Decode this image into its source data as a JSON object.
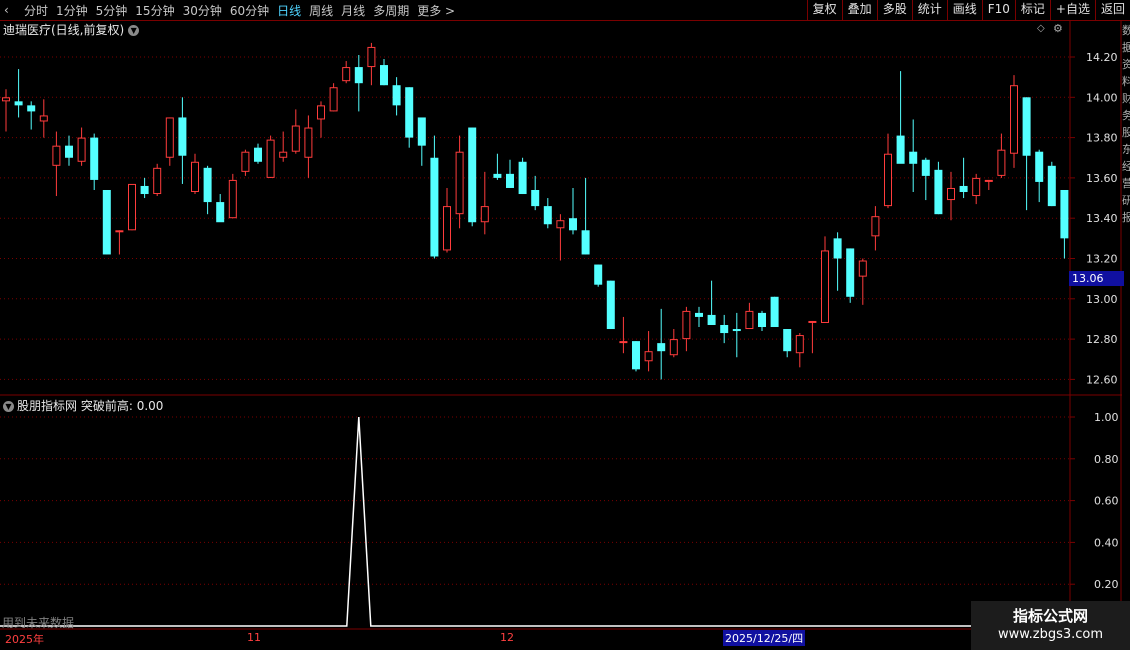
{
  "toolbar": {
    "back_glyph": "‹",
    "periods": [
      "分时",
      "1分钟",
      "5分钟",
      "15分钟",
      "30分钟",
      "60分钟",
      "日线",
      "周线",
      "月线",
      "多周期",
      "更多 >"
    ],
    "active_period": "日线",
    "tools": [
      "复权",
      "叠加",
      "多股",
      "统计",
      "画线",
      "F10",
      "标记",
      "+自选",
      "返回"
    ]
  },
  "main_title": "迪瑞医疗(日线,前复权)",
  "current_price_label": "13.06",
  "price_axis_labels": [
    "14.20",
    "14.00",
    "13.80",
    "13.60",
    "13.40",
    "13.20",
    "13.00",
    "12.80",
    "12.60"
  ],
  "indicator": {
    "name": "股朋指标网",
    "label": "突破前高:",
    "value": "0.00",
    "axis_labels": [
      "1.00",
      "0.80",
      "0.60",
      "0.40",
      "0.20"
    ],
    "peak_value": 1.0
  },
  "future_note": "用到未来数据",
  "date_axis": {
    "year": "2025年",
    "nov": "11",
    "dec": "12",
    "cursor_date": "2025/12/25/四"
  },
  "side_strip_text": "数据资料财务股东经营研报",
  "watermark": {
    "line1": "指标公式网",
    "line2": "www.zbgs3.com"
  },
  "colors": {
    "up": "#ff3c3c",
    "down": "#54ffff",
    "grid": "#7a0000",
    "line": "#ffffff"
  },
  "chart_data": {
    "type": "candlestick",
    "ylim": [
      12.52,
      14.3
    ],
    "candles": [
      [
        13.98,
        14.0,
        14.04,
        13.83
      ],
      [
        13.98,
        13.96,
        14.14,
        13.9
      ],
      [
        13.96,
        13.93,
        13.98,
        13.84
      ],
      [
        13.88,
        13.91,
        13.99,
        13.8
      ],
      [
        13.66,
        13.76,
        13.83,
        13.51
      ],
      [
        13.76,
        13.7,
        13.81,
        13.66
      ],
      [
        13.68,
        13.8,
        13.85,
        13.66
      ],
      [
        13.8,
        13.59,
        13.82,
        13.54
      ],
      [
        13.54,
        13.22,
        13.54,
        13.22
      ],
      [
        13.34,
        13.34,
        13.34,
        13.22
      ],
      [
        13.34,
        13.57,
        13.57,
        13.34
      ],
      [
        13.56,
        13.52,
        13.6,
        13.5
      ],
      [
        13.52,
        13.65,
        13.67,
        13.51
      ],
      [
        13.7,
        13.9,
        13.9,
        13.66
      ],
      [
        13.9,
        13.71,
        14.0,
        13.57
      ],
      [
        13.53,
        13.68,
        13.72,
        13.52
      ],
      [
        13.65,
        13.48,
        13.66,
        13.42
      ],
      [
        13.48,
        13.38,
        13.52,
        13.39
      ],
      [
        13.4,
        13.59,
        13.62,
        13.4
      ],
      [
        13.63,
        13.73,
        13.74,
        13.61
      ],
      [
        13.75,
        13.68,
        13.77,
        13.67
      ],
      [
        13.6,
        13.79,
        13.81,
        13.6
      ],
      [
        13.7,
        13.73,
        13.83,
        13.68
      ],
      [
        13.73,
        13.86,
        13.94,
        13.72
      ],
      [
        13.7,
        13.85,
        13.91,
        13.6
      ],
      [
        13.89,
        13.96,
        13.98,
        13.8
      ],
      [
        13.93,
        14.05,
        14.07,
        13.93
      ],
      [
        14.08,
        14.15,
        14.18,
        14.07
      ],
      [
        14.15,
        14.07,
        14.21,
        13.93
      ],
      [
        14.15,
        14.25,
        14.27,
        14.06
      ],
      [
        14.16,
        14.06,
        14.19,
        14.06
      ],
      [
        14.06,
        13.96,
        14.1,
        13.91
      ],
      [
        14.05,
        13.8,
        14.05,
        13.75
      ],
      [
        13.9,
        13.76,
        13.89,
        13.66
      ],
      [
        13.7,
        13.21,
        13.81,
        13.2
      ],
      [
        13.24,
        13.46,
        13.55,
        13.23
      ],
      [
        13.42,
        13.73,
        13.81,
        13.35
      ],
      [
        13.85,
        13.38,
        13.85,
        13.36
      ],
      [
        13.38,
        13.46,
        13.63,
        13.32
      ],
      [
        13.62,
        13.6,
        13.72,
        13.59
      ],
      [
        13.62,
        13.55,
        13.69,
        13.55
      ],
      [
        13.68,
        13.52,
        13.7,
        13.52
      ],
      [
        13.54,
        13.46,
        13.61,
        13.44
      ],
      [
        13.46,
        13.37,
        13.5,
        13.35
      ],
      [
        13.35,
        13.39,
        13.42,
        13.19
      ],
      [
        13.4,
        13.34,
        13.55,
        13.32
      ],
      [
        13.34,
        13.22,
        13.6,
        13.22
      ],
      [
        13.17,
        13.07,
        13.17,
        13.06
      ],
      [
        13.09,
        12.85,
        13.09,
        12.85
      ],
      [
        12.79,
        12.79,
        12.91,
        12.73
      ],
      [
        12.79,
        12.65,
        12.79,
        12.64
      ],
      [
        12.69,
        12.74,
        12.84,
        12.64
      ],
      [
        12.78,
        12.74,
        12.95,
        12.6
      ],
      [
        12.72,
        12.8,
        12.85,
        12.71
      ],
      [
        12.8,
        12.94,
        12.96,
        12.74
      ],
      [
        12.93,
        12.91,
        12.96,
        12.86
      ],
      [
        12.92,
        12.87,
        13.09,
        12.87
      ],
      [
        12.87,
        12.83,
        12.92,
        12.78
      ],
      [
        12.85,
        12.84,
        12.93,
        12.71
      ],
      [
        12.85,
        12.94,
        12.98,
        12.85
      ],
      [
        12.93,
        12.86,
        12.94,
        12.84
      ],
      [
        13.01,
        12.86,
        13.01,
        12.86
      ],
      [
        12.85,
        12.74,
        12.85,
        12.71
      ],
      [
        12.73,
        12.82,
        12.83,
        12.66
      ],
      [
        12.89,
        12.89,
        12.89,
        12.73
      ],
      [
        12.88,
        13.24,
        13.31,
        12.98
      ],
      [
        13.3,
        13.2,
        13.33,
        13.04
      ],
      [
        13.25,
        13.01,
        13.25,
        12.98
      ],
      [
        13.11,
        13.19,
        13.2,
        12.97
      ],
      [
        13.31,
        13.41,
        13.46,
        13.24
      ],
      [
        13.46,
        13.72,
        13.82,
        13.45
      ],
      [
        13.81,
        13.67,
        14.13,
        13.71
      ],
      [
        13.73,
        13.67,
        13.89,
        13.53
      ],
      [
        13.69,
        13.61,
        13.7,
        13.49
      ],
      [
        13.64,
        13.42,
        13.68,
        13.42
      ],
      [
        13.49,
        13.55,
        13.63,
        13.39
      ],
      [
        13.56,
        13.53,
        13.7,
        13.5
      ],
      [
        13.51,
        13.6,
        13.62,
        13.47
      ],
      [
        13.59,
        13.59,
        13.59,
        13.54
      ],
      [
        13.61,
        13.74,
        13.82,
        13.6
      ],
      [
        13.72,
        14.06,
        14.11,
        13.65
      ],
      [
        14.0,
        13.71,
        14.0,
        13.44
      ],
      [
        13.73,
        13.58,
        13.74,
        13.48
      ],
      [
        13.66,
        13.46,
        13.68,
        13.46
      ],
      [
        13.54,
        13.3,
        13.54,
        13.2
      ]
    ],
    "signal": {
      "peak_index": 28,
      "baseline": 0.0,
      "peak": 1.0
    }
  }
}
